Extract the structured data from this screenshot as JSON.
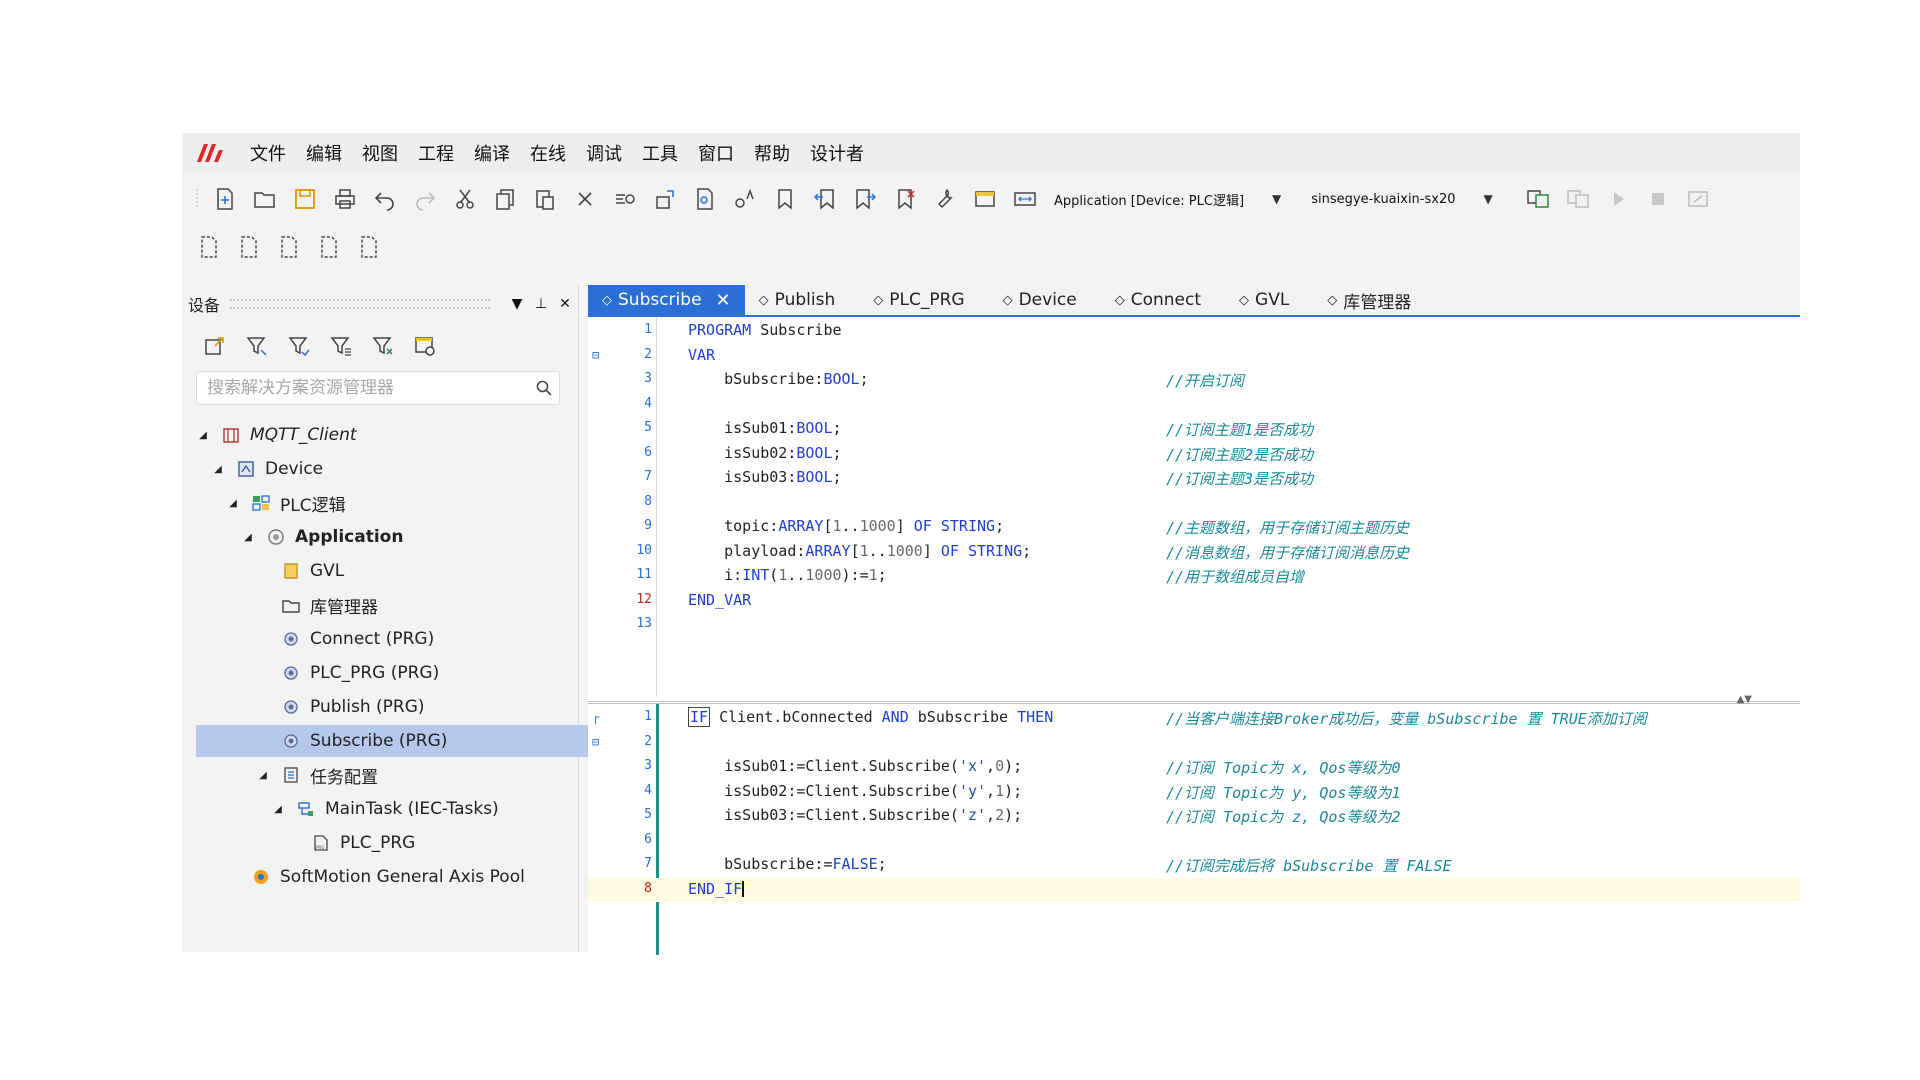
{
  "menu": [
    "文件",
    "编辑",
    "视图",
    "工程",
    "编译",
    "在线",
    "调试",
    "工具",
    "窗口",
    "帮助",
    "设计者"
  ],
  "toolbar": {
    "application_combo": "Application [Device: PLC逻辑]",
    "device_combo": "sinsegye-kuaixin-sx20"
  },
  "left_panel": {
    "title": "设备",
    "search_placeholder": "搜索解决方案资源管理器",
    "tree": [
      {
        "label": "MQTT_Client",
        "depth": 0,
        "toggle": "◢",
        "icon": "project-icon",
        "style": "italic"
      },
      {
        "label": "Device",
        "depth": 1,
        "toggle": "◢",
        "icon": "device-icon",
        "style": ""
      },
      {
        "label": "PLC逻辑",
        "depth": 2,
        "toggle": "◢",
        "icon": "plc-logic-icon",
        "style": ""
      },
      {
        "label": "Application",
        "depth": 3,
        "toggle": "◢",
        "icon": "application-icon",
        "style": "bold"
      },
      {
        "label": "GVL",
        "depth": 4,
        "toggle": "",
        "icon": "gvl-icon",
        "style": ""
      },
      {
        "label": "库管理器",
        "depth": 4,
        "toggle": "",
        "icon": "library-icon",
        "style": ""
      },
      {
        "label": "Connect (PRG)",
        "depth": 4,
        "toggle": "",
        "icon": "prg-icon",
        "style": ""
      },
      {
        "label": "PLC_PRG (PRG)",
        "depth": 4,
        "toggle": "",
        "icon": "prg-icon",
        "style": ""
      },
      {
        "label": "Publish (PRG)",
        "depth": 4,
        "toggle": "",
        "icon": "prg-icon",
        "style": ""
      },
      {
        "label": "Subscribe (PRG)",
        "depth": 4,
        "toggle": "",
        "icon": "prg-icon",
        "style": "selected"
      },
      {
        "label": "任务配置",
        "depth": 4,
        "toggle": "◢",
        "icon": "task-config-icon",
        "style": ""
      },
      {
        "label": "MainTask (IEC-Tasks)",
        "depth": 5,
        "toggle": "◢",
        "icon": "task-icon",
        "style": ""
      },
      {
        "label": "PLC_PRG",
        "depth": 6,
        "toggle": "",
        "icon": "program-call-icon",
        "style": ""
      },
      {
        "label": "SoftMotion General Axis Pool",
        "depth": 2,
        "toggle": "",
        "icon": "axis-pool-icon",
        "style": ""
      }
    ]
  },
  "tabs": [
    "Subscribe",
    "Publish",
    "PLC_PRG",
    "Device",
    "Connect",
    "GVL",
    "库管理器"
  ],
  "decl_lines": [
    {
      "n": "1",
      "code": "PROGRAM Subscribe",
      "comment": ""
    },
    {
      "n": "2",
      "code": "VAR",
      "comment": ""
    },
    {
      "n": "3",
      "code": "    bSubscribe:BOOL;",
      "comment": "//开启订阅"
    },
    {
      "n": "4",
      "code": "",
      "comment": ""
    },
    {
      "n": "5",
      "code": "    isSub01:BOOL;",
      "comment": "//订阅主题1是否成功"
    },
    {
      "n": "6",
      "code": "    isSub02:BOOL;",
      "comment": "//订阅主题2是否成功"
    },
    {
      "n": "7",
      "code": "    isSub03:BOOL;",
      "comment": "//订阅主题3是否成功"
    },
    {
      "n": "8",
      "code": "",
      "comment": ""
    },
    {
      "n": "9",
      "code": "    topic:ARRAY[1..1000] OF STRING;",
      "comment": "//主题数组，用于存储订阅主题历史"
    },
    {
      "n": "10",
      "code": "    playload:ARRAY[1..1000] OF STRING;",
      "comment": "//消息数组，用于存储订阅消息历史"
    },
    {
      "n": "11",
      "code": "    i:INT(1..1000):=1;",
      "comment": "//用于数组成员自增"
    },
    {
      "n": "12",
      "code": "END_VAR",
      "comment": ""
    },
    {
      "n": "13",
      "code": "",
      "comment": ""
    }
  ],
  "impl_lines": [
    {
      "n": "1",
      "code": "IF Client.bConnected AND bSubscribe THEN",
      "comment": "//当客户端连接Broker成功后，变量 bSubscribe 置 TRUE添加订阅"
    },
    {
      "n": "2",
      "code": "",
      "comment": ""
    },
    {
      "n": "3",
      "code": "    isSub01:=Client.Subscribe('x',0);",
      "comment": "//订阅 Topic为 x, Qos等级为0"
    },
    {
      "n": "4",
      "code": "    isSub02:=Client.Subscribe('y',1);",
      "comment": "//订阅 Topic为 y, Qos等级为1"
    },
    {
      "n": "5",
      "code": "    isSub03:=Client.Subscribe('z',2);",
      "comment": "//订阅 Topic为 z, Qos等级为2"
    },
    {
      "n": "6",
      "code": "",
      "comment": ""
    },
    {
      "n": "7",
      "code": "    bSubscribe:=FALSE;",
      "comment": "//订阅完成后将 bSubscribe 置 FALSE"
    },
    {
      "n": "8",
      "code": "END_IF",
      "comment": ""
    }
  ]
}
